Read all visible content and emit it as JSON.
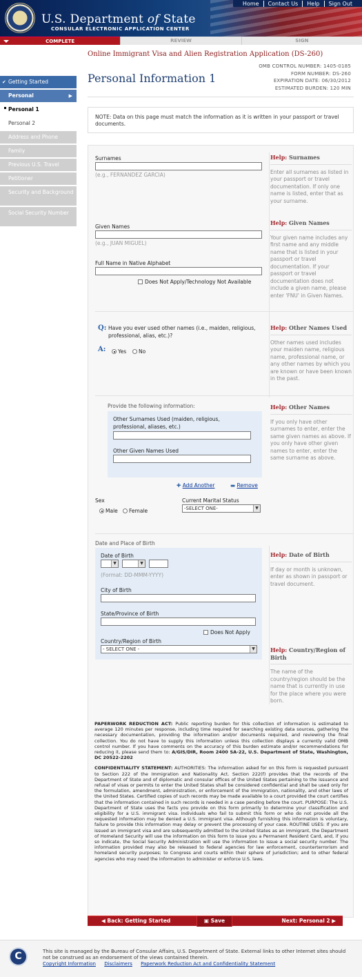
{
  "top_nav": [
    "Home",
    "Contact Us",
    "Help",
    "Sign Out"
  ],
  "banner": {
    "dept_prefix": "U.S. Department",
    "dept_of": "of",
    "dept_suffix": "State",
    "sub": "CONSULAR ELECTRONIC APPLICATION CENTER"
  },
  "steps": [
    "COMPLETE",
    "REVIEW",
    "SIGN"
  ],
  "app_title": "Online Immigrant Visa and Alien Registration Application (DS-260)",
  "omb": [
    "OMB CONTROL NUMBER:  1405-0185",
    "FORM NUMBER:       DS-260",
    "EXPIRATION DATE: 06/30/2012",
    "ESTIMATED BURDEN:      120 MIN"
  ],
  "page_title": "Personal Information 1",
  "sidebar": {
    "items": [
      "Getting Started",
      "Personal",
      "Personal 1",
      "Personal 2",
      "Address and Phone",
      "Family",
      "Previous U.S. Travel",
      "Petitioner",
      "Security and Background",
      "Social Security Number"
    ]
  },
  "note": "NOTE: Data on this page must match the information as it is written in your passport or travel documents.",
  "form": {
    "surnames_label": "Surnames",
    "surnames_example": "(e.g., FERNANDEZ GARCIA)",
    "given_label": "Given Names",
    "given_example": "(e.g., JUAN MIGUEL)",
    "native_label": "Full Name in Native Alphabet",
    "does_not_apply_tech": "Does Not Apply/Technology Not Available",
    "question": "Have you ever used other names (i.e., maiden, religious, professional, alias, etc.)?",
    "q_marker": "Q:",
    "a_marker": "A:",
    "yes": "Yes",
    "no": "No",
    "provide_info": "Provide the following information:",
    "other_surnames_label": "Other Surnames Used (maiden, religious, professional, aliases, etc.)",
    "other_given_label": "Other Given Names Used",
    "add_another": "Add Another",
    "remove": "Remove",
    "sex_label": "Sex",
    "male": "Male",
    "female": "Female",
    "marital_label": "Current Marital Status",
    "marital_value": "-SELECT ONE-",
    "dob_section": "Date and Place of Birth",
    "dob_label": "Date of Birth",
    "dob_format": "(Format: DD-MMM-YYYY)",
    "city_label": "City of Birth",
    "state_label": "State/Province of Birth",
    "does_not_apply": "Does Not Apply",
    "country_label": "Country/Region of Birth",
    "country_value": "- SELECT ONE -"
  },
  "help": {
    "prefix": "Help:",
    "surnames_title": "Surnames",
    "surnames_text": "Enter all surnames as listed in your passport or travel documentation. If only one name is listed, enter that as your surname.",
    "given_title": "Given Names",
    "given_text": "Your given name includes any first name and any middle name that is listed in your passport or travel documentation. If your passport or travel documentation does not include a given name, please enter 'FNU' in Given Names.",
    "other_used_title": "Other Names Used",
    "other_used_text": "Other names used includes your maiden name, religious name, professional name, or any other names by which you are known or have been known in the past.",
    "other_names_title": "Other Names",
    "other_names_text": "If you only have other surnames to enter, enter the same given names as above. If you only have other given names to enter, enter the same surname as above.",
    "dob_title": "Date of Birth",
    "dob_text": "If day or month is unknown, enter as shown in passport or travel document.",
    "country_title": "Country/Region of Birth",
    "country_text": "The name of the country/region should be the name that is currently in use for the place where you were born."
  },
  "legal": {
    "prа_title": "PAPERWORK REDUCTION ACT:",
    "pra_text": "Public reporting burden for this collection of information is estimated to average 120 minutes per response, including time required for searching existing data sources, gathering the necessary documentation, providing the information and/or documents required, and reviewing the final collection. You do not have to supply this information unless this collection displays a currently valid OMB control number. If you have comments on the accuracy of this burden estimate and/or recommendations for reducing it, please send them to:",
    "pra_address": "A/GIS/DIR, Room 2400 SA-22, U.S. Department of State, Washington, DC 20522-2202",
    "conf_title": "CONFIDENTIALITY STATEMENT:",
    "conf_text": "AUTHORITIES: The information asked for on this form is requested pursuant to Section 222 of the Immigration and Nationality Act. Section 222(f) provides that the records of the Department of State and of diplomatic and consular offices of the United States pertaining to the issuance and refusal of visas or permits to enter the United States shall be considered confidential and shall be used only for the formulation, amendment, administration, or enforcement of the immigration, nationality, and other laws of the United States. Certified copies of such records may be made available to a court provided the court certifies that the information contained in such records is needed in a case pending before the court. PURPOSE: The U.S. Department of State uses the facts you provide on this form primarily to determine your classification and eligibility for a U.S. immigrant visa. Individuals who fail to submit this form or who do not provide all the requested information may be denied a U.S. immigrant visa. Although furnishing this information is voluntary, failure to provide this information may delay or prevent the processing of your case. ROUTINE USES: If you are issued an immigrant visa and are subsequently admitted to the United States as an immigrant, the Department of Homeland Security will use the information on this form to issue you a Permanent Resident Card, and, if you so indicate, the Social Security Administration will use the information to issue a social security number. The information provided may also be released to federal agencies for law enforcement, counterterrorism and homeland security purposes; to Congress and courts within their sphere of jurisdiction; and to other federal agencies who may need the information to administer or enforce U.S. laws."
  },
  "navbar": {
    "back": "◀ Back: Getting Started",
    "save": "Save",
    "next": "Next: Personal 2 ▶"
  },
  "footer": {
    "text": "This site is managed by the Bureau of Consular Affairs, U.S. Department of State. External links to other Internet sites should not be construed as an endorsement of the views contained therein.",
    "links": [
      "Copyright Information",
      "Disclaimers",
      "Paperwork Reduction Act and Confidentiality Statement"
    ]
  },
  "colors": {
    "navy": "#0d2556",
    "red": "#a8161d",
    "title_blue": "#1f3f70",
    "help_red": "#a0272d"
  }
}
